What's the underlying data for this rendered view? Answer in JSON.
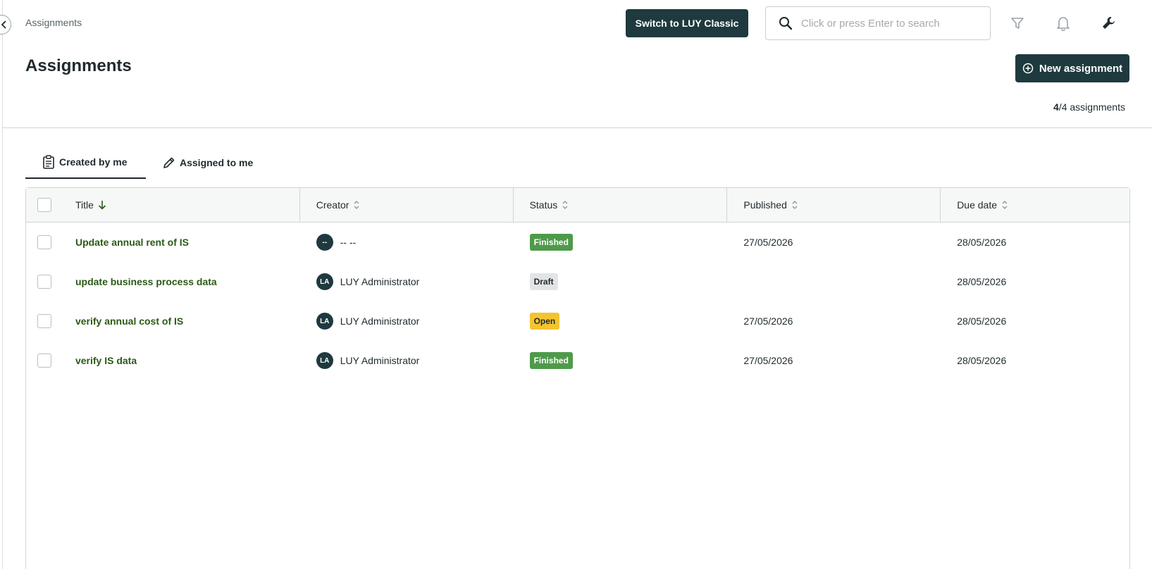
{
  "breadcrumb": "Assignments",
  "header": {
    "switch_label": "Switch to LUY Classic",
    "search_placeholder": "Click or press Enter to search"
  },
  "page": {
    "title": "Assignments",
    "new_label": "New assignment",
    "count_shown": "4",
    "count_total": "/4 assignments"
  },
  "tabs": [
    {
      "label": "Created by me",
      "icon": "clipboard-icon",
      "active": true
    },
    {
      "label": "Assigned to me",
      "icon": "pencil-icon",
      "active": false
    }
  ],
  "table": {
    "columns": {
      "title": "Title",
      "creator": "Creator",
      "status": "Status",
      "published": "Published",
      "due": "Due date"
    },
    "rows": [
      {
        "title": "Update annual rent of IS",
        "avatar": "--",
        "creator": "-- --",
        "status": "Finished",
        "published": "27/05/2026",
        "due": "28/05/2026"
      },
      {
        "title": "update business process data",
        "avatar": "LA",
        "creator": "LUY Administrator",
        "status": "Draft",
        "published": "",
        "due": "28/05/2026"
      },
      {
        "title": "verify annual cost of IS",
        "avatar": "LA",
        "creator": "LUY Administrator",
        "status": "Open",
        "published": "27/05/2026",
        "due": "28/05/2026"
      },
      {
        "title": "verify IS data",
        "avatar": "LA",
        "creator": "LUY Administrator",
        "status": "Finished",
        "published": "27/05/2026",
        "due": "28/05/2026"
      }
    ]
  },
  "colors": {
    "primary": "#1e3a3f",
    "link": "#2a5a14",
    "finished": "#4f9a4a",
    "draft": "#e2e4e5",
    "open": "#f4c430"
  }
}
